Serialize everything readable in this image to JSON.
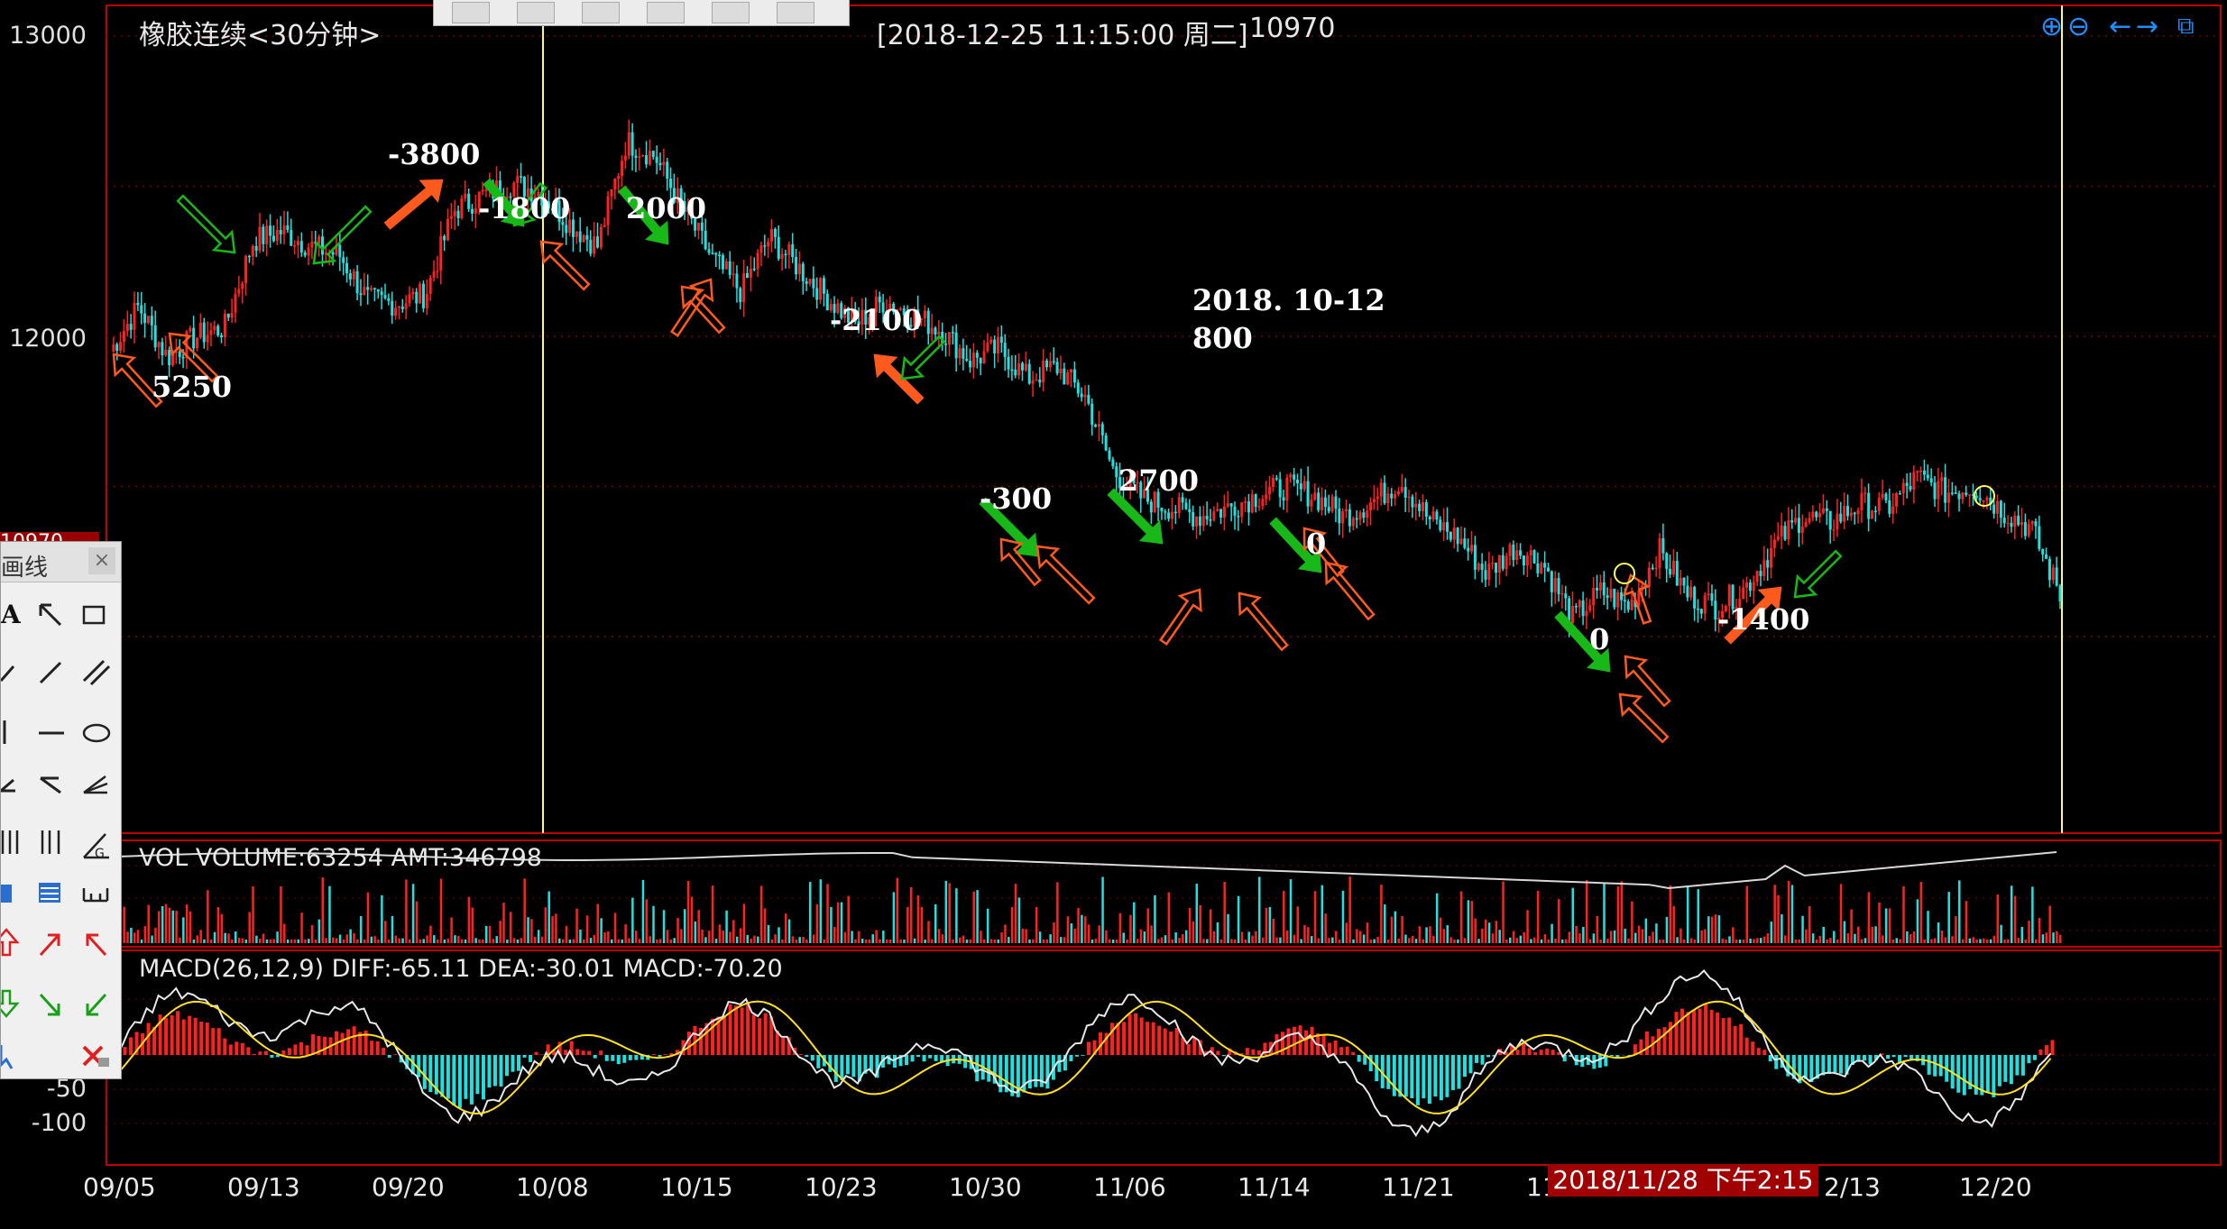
{
  "header": {
    "title": "橡胶连续<30分钟>",
    "info": "[2018-12-25  11:15:00 周二]",
    "price": "10970"
  },
  "price_axis": [
    "13000",
    "12000"
  ],
  "macd_axis": [
    "-50",
    "-100"
  ],
  "current_price_tag": "10970",
  "date_axis": [
    "09/05",
    "09/13",
    "09/20",
    "10/08",
    "10/15",
    "10/23",
    "10/30",
    "11/06",
    "11/14",
    "11/21",
    "11",
    "2/13",
    "12/20"
  ],
  "cursor_label": "2018/11/28 下午2:15",
  "volume_label": "VOL  VOLUME:63254 AMT:346798",
  "macd_label": "MACD(26,12,9)  DIFF:-65.11 DEA:-30.01 MACD:-70.20",
  "annotations": {
    "a1": "5250",
    "a2": "-3800",
    "a3": "-1800",
    "a4": "2000",
    "a5": "-2100",
    "a6": "2018. 10-12",
    "a7": "800",
    "a8": "-300",
    "a9": "2700",
    "a10": "0",
    "a11": "0",
    "a12": "-1400"
  },
  "tool_panel": {
    "title": "画线",
    "close": "×"
  },
  "colors": {
    "up": "#ff2020",
    "down": "#20e0e0",
    "buy_arrow": "#18b818",
    "sell_arrow": "#ff5a1e",
    "cursor_line": "#ffff60",
    "frame": "#c00000"
  },
  "chart_data": {
    "type": "candlestick",
    "title": "橡胶连续<30分钟>",
    "ylim": [
      11450,
      13000
    ],
    "yticks": [
      13000,
      12000
    ],
    "x_labels": [
      "09/05",
      "09/13",
      "09/20",
      "10/08",
      "10/15",
      "10/23",
      "10/30",
      "11/06",
      "11/14",
      "11/21",
      "11",
      "2/13",
      "12/20"
    ],
    "price_path": [
      [
        0,
        11950
      ],
      [
        1,
        12100
      ],
      [
        2,
        11930
      ],
      [
        3,
        12000
      ],
      [
        4,
        12030
      ],
      [
        5,
        12320
      ],
      [
        6,
        12350
      ],
      [
        7,
        12300
      ],
      [
        8,
        12270
      ],
      [
        9,
        12120
      ],
      [
        10,
        12110
      ],
      [
        11,
        12140
      ],
      [
        12,
        12420
      ],
      [
        13,
        12470
      ],
      [
        14,
        12510
      ],
      [
        15,
        12480
      ],
      [
        16,
        12380
      ],
      [
        17,
        12300
      ],
      [
        18,
        12650
      ],
      [
        19,
        12600
      ],
      [
        20,
        12420
      ],
      [
        21,
        12260
      ],
      [
        22,
        12150
      ],
      [
        23,
        12330
      ],
      [
        24,
        12230
      ],
      [
        25,
        12130
      ],
      [
        26,
        12040
      ],
      [
        27,
        12120
      ],
      [
        28,
        12070
      ],
      [
        29,
        12020
      ],
      [
        30,
        11920
      ],
      [
        31,
        11960
      ],
      [
        32,
        11860
      ],
      [
        33,
        11900
      ],
      [
        34,
        11800
      ],
      [
        35,
        11550
      ],
      [
        36,
        11460
      ],
      [
        37,
        11430
      ],
      [
        38,
        11400
      ],
      [
        39,
        11430
      ],
      [
        40,
        11470
      ],
      [
        41,
        11500
      ],
      [
        42,
        11470
      ],
      [
        43,
        11400
      ],
      [
        44,
        11450
      ],
      [
        45,
        11520
      ],
      [
        46,
        11390
      ],
      [
        47,
        11330
      ],
      [
        48,
        11210
      ],
      [
        49,
        11300
      ],
      [
        50,
        11240
      ],
      [
        51,
        11060
      ],
      [
        52,
        11150
      ],
      [
        53,
        11100
      ],
      [
        54,
        11290
      ],
      [
        55,
        11140
      ],
      [
        56,
        11100
      ],
      [
        57,
        11160
      ],
      [
        58,
        11300
      ],
      [
        59,
        11400
      ],
      [
        60,
        11380
      ],
      [
        61,
        11440
      ],
      [
        62,
        11430
      ],
      [
        63,
        11530
      ],
      [
        64,
        11480
      ],
      [
        65,
        11500
      ],
      [
        66,
        11420
      ],
      [
        67,
        11360
      ],
      [
        68,
        11140
      ]
    ],
    "volume": {
      "name": "VOLUME",
      "last": 63254,
      "amt": 346798
    },
    "macd": {
      "params": "26,12,9",
      "diff": -65.11,
      "dea": -30.01,
      "macd": -70.2,
      "yticks": [
        -50,
        -100
      ]
    }
  }
}
